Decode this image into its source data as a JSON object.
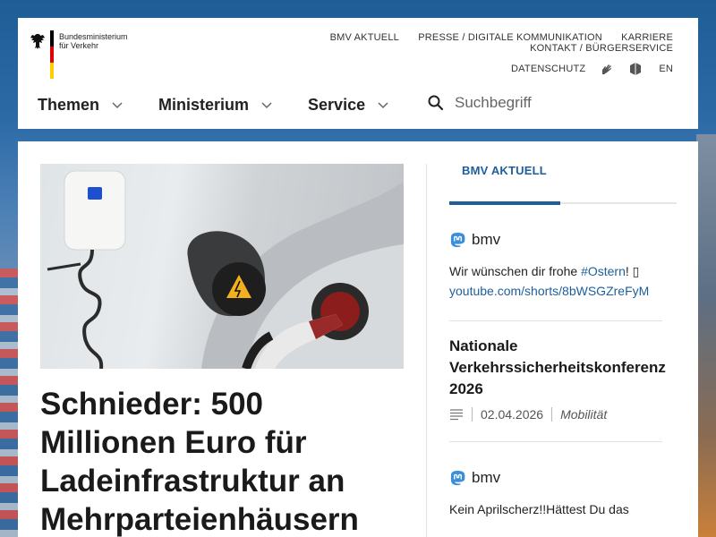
{
  "header": {
    "logo": {
      "line1": "Bundesministerium",
      "line2": "für Verkehr"
    },
    "top_links": [
      "BMV AKTUELL",
      "PRESSE / DIGITALE KOMMUNIKATION",
      "KARRIERE",
      "KONTAKT / BÜRGERSERVICE"
    ],
    "datenschutz": "DATENSCHUTZ",
    "icons": [
      "sign-language-icon",
      "easy-language-icon"
    ],
    "lang": "EN",
    "main_nav": [
      "Themen",
      "Ministerium",
      "Service"
    ],
    "search": {
      "placeholder": "Suchbegriff"
    }
  },
  "lead": {
    "headline": "Schnieder: 500 Millionen Euro für Ladeinfrastruktur an Mehrparteienhäusern"
  },
  "sidebar": {
    "tab": "BMV AKTUELL",
    "posts": [
      {
        "account": "bmv",
        "text": "Wir wünschen dir frohe ",
        "hashtag": "#Ostern",
        "after": "! ",
        "emoji": "▯",
        "link": "youtube.com/shorts/8bWSGZreFyM"
      },
      {
        "account": "bmv",
        "text": "Kein Aprilscherz!!Hättest Du das"
      }
    ],
    "article": {
      "title": "Nationale Verkehrssicherheitskonferenz 2026",
      "date": "02.04.2026",
      "category": "Mobilität"
    }
  },
  "colors": {
    "accent": "#1f5e9a",
    "flag_black": "#000000",
    "flag_red": "#dd0000",
    "flag_gold": "#ffcc00"
  }
}
